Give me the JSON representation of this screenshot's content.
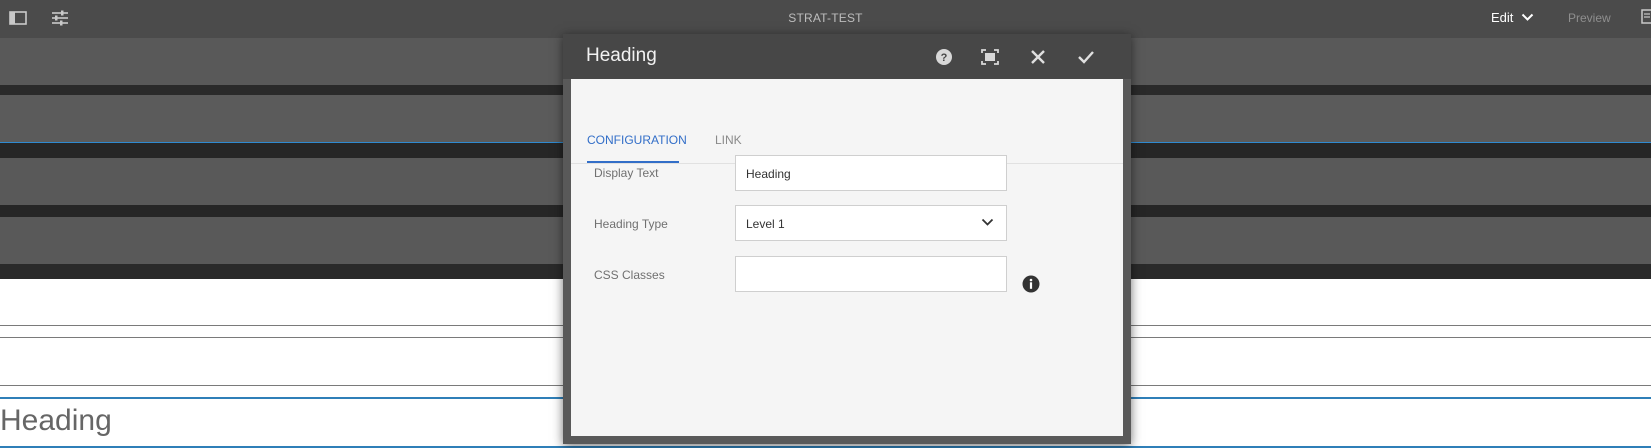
{
  "toolbar": {
    "title": "STRAT-TEST",
    "edit_label": "Edit",
    "preview_label": "Preview",
    "icons": [
      "side-panel-icon",
      "page-properties-icon",
      "chevron-down-icon"
    ]
  },
  "page": {
    "heading_text": "Heading"
  },
  "dialog": {
    "title": "Heading",
    "tabs": [
      {
        "label": "CONFIGURATION",
        "active": true
      },
      {
        "label": "LINK",
        "active": false
      }
    ],
    "fields": {
      "display_text": {
        "label": "Display Text",
        "value": "Heading"
      },
      "heading_type": {
        "label": "Heading Type",
        "value": "Level 1"
      },
      "css_classes": {
        "label": "CSS Classes",
        "value": ""
      }
    },
    "header_icons": [
      "help-icon",
      "fullscreen-icon",
      "close-icon",
      "done-icon"
    ]
  },
  "colors": {
    "accent": "#326ec8",
    "toolbar_bg": "#4b4b4b",
    "dialog_header_bg": "#474747",
    "selection_blue": "#2f7fb8"
  }
}
